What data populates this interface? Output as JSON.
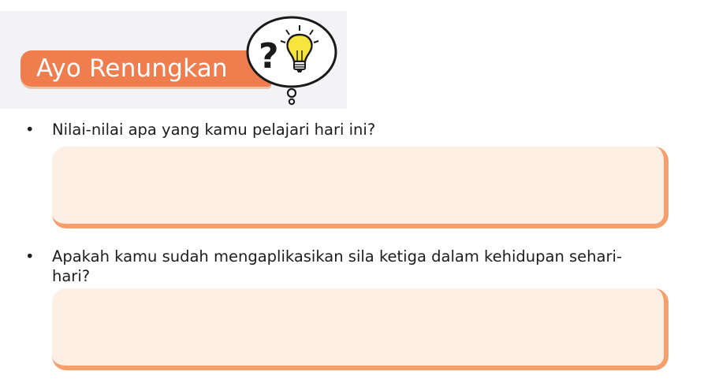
{
  "section": {
    "title": "Ayo Renungkan",
    "bubble_icons": [
      "question-mark-icon",
      "lightbulb-icon"
    ]
  },
  "questions": [
    {
      "bullet": "•",
      "text": "Nilai-nilai apa yang kamu pelajari hari ini?"
    },
    {
      "bullet": "•",
      "text": "Apakah kamu sudah mengaplikasikan sila ketiga dalam kehidupan sehari-\nhari?"
    }
  ],
  "colors": {
    "title_pill": "#f07d4e",
    "answer_fill": "#feefe5",
    "answer_shadow": "#f5a06c",
    "bulb": "#f7e43c"
  }
}
